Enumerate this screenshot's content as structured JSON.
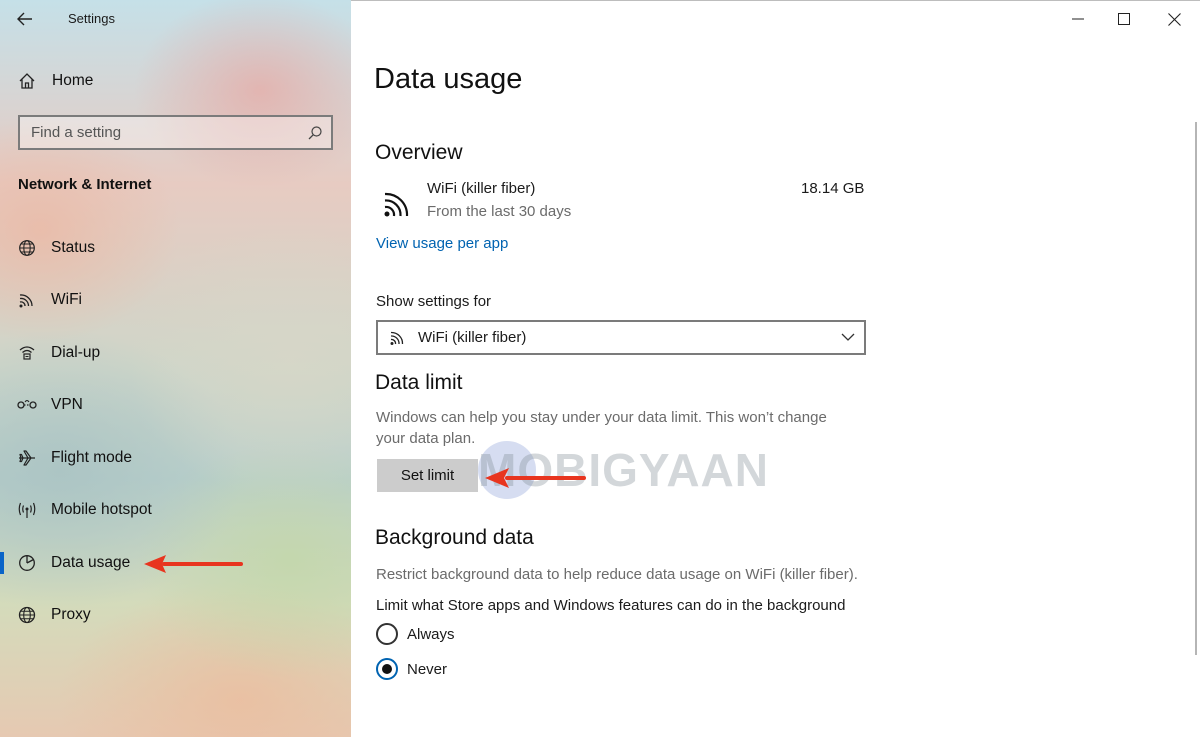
{
  "window": {
    "title": "Settings"
  },
  "sidebar": {
    "home_label": "Home",
    "search_placeholder": "Find a setting",
    "section_header": "Network & Internet",
    "items": [
      {
        "label": "Status",
        "icon": "globe-status-icon"
      },
      {
        "label": "WiFi",
        "icon": "wifi-icon"
      },
      {
        "label": "Dial-up",
        "icon": "dialup-icon"
      },
      {
        "label": "VPN",
        "icon": "vpn-icon"
      },
      {
        "label": "Flight mode",
        "icon": "airplane-icon"
      },
      {
        "label": "Mobile hotspot",
        "icon": "hotspot-icon"
      },
      {
        "label": "Data usage",
        "icon": "pie-chart-icon",
        "selected": true
      },
      {
        "label": "Proxy",
        "icon": "globe-icon"
      }
    ]
  },
  "main": {
    "page_title": "Data usage",
    "overview": {
      "title": "Overview",
      "network_name": "WiFi (killer fiber)",
      "period": "From the last 30 days",
      "usage": "18.14 GB",
      "link": "View usage per app"
    },
    "show_settings": {
      "label": "Show settings for",
      "selected": "WiFi (killer fiber)"
    },
    "data_limit": {
      "title": "Data limit",
      "description": "Windows can help you stay under your data limit. This won’t change your data plan.",
      "button": "Set limit"
    },
    "background_data": {
      "title": "Background data",
      "description": "Restrict background data to help reduce data usage on WiFi (killer fiber).",
      "question": "Limit what Store apps and Windows features can do in the background",
      "options": [
        {
          "label": "Always",
          "checked": false
        },
        {
          "label": "Never",
          "checked": true
        }
      ]
    }
  },
  "watermark": "MOBIGYAAN",
  "colors": {
    "accent": "#0063b1",
    "selection_bar": "#0a64c8",
    "annotation_arrow": "#e8351f"
  }
}
